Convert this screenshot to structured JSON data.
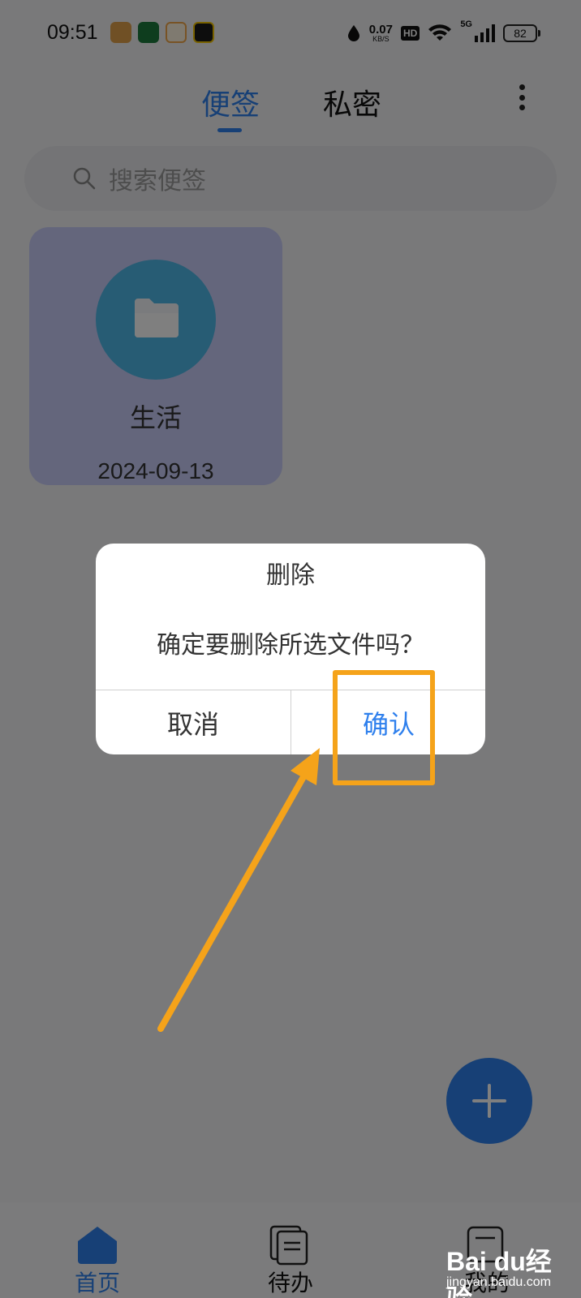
{
  "status_bar": {
    "time": "09:51",
    "net_speed_value": "0.07",
    "net_speed_unit": "KB/S",
    "hd_badge": "HD",
    "signal_label": "5G",
    "battery": "82",
    "app_icon_colors": [
      "#e0a14a",
      "#1d7a3d",
      "#f1a64a",
      "#1b1b1b"
    ]
  },
  "header": {
    "tabs": [
      {
        "label": "便签",
        "active": true
      },
      {
        "label": "私密",
        "active": false
      }
    ],
    "accent_color": "#2f80ed"
  },
  "search": {
    "placeholder": "搜索便签"
  },
  "folder_card": {
    "title": "生活",
    "date": "2024-09-13",
    "icon": "folder-icon"
  },
  "dialog": {
    "title": "删除",
    "message": "确定要删除所选文件吗？",
    "cancel_label": "取消",
    "confirm_label": "确认"
  },
  "bottom_nav": {
    "items": [
      {
        "label": "首页",
        "icon": "home-icon",
        "active": true
      },
      {
        "label": "待办",
        "icon": "todo-icon",
        "active": false
      },
      {
        "label": "我的",
        "icon": "profile-icon",
        "active": false
      }
    ]
  },
  "annotation": {
    "highlight_color": "#f5a31a"
  },
  "watermark": {
    "brand": "Bai du",
    "suffix": "经验",
    "url": "jingyan.baidu.com"
  }
}
